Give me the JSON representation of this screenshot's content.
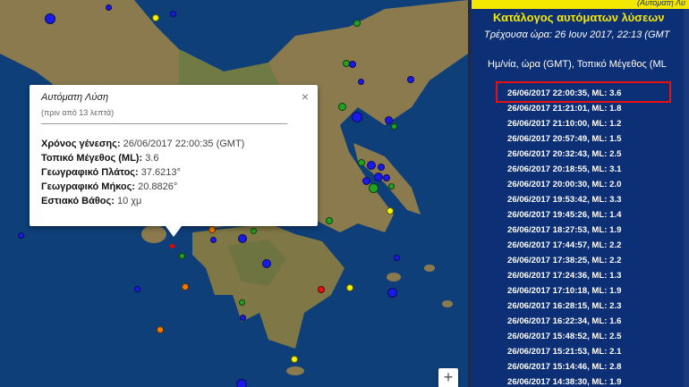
{
  "popup": {
    "title": "Αυτόματη Λύση",
    "subtitle": "(πριν από 13 λεπτά)",
    "close": "×",
    "rows": [
      {
        "label": "Χρόνος γένεσης:",
        "value": "26/06/2017  22:00:35 (GMT)"
      },
      {
        "label": "Τοπικό Μέγεθος (ML):",
        "value": "3.6"
      },
      {
        "label": "Γεωγραφικό Πλάτος:",
        "value": "37.6213°"
      },
      {
        "label": "Γεωγραφικό Μήκος:",
        "value": "20.8826°"
      },
      {
        "label": "Εστιακό Βάθος:",
        "value": "10 χμ"
      }
    ]
  },
  "map": {
    "zoom_in": "+"
  },
  "panel": {
    "top_label": "(Αυτόματη Λύ",
    "heading": "Κατάλογος αυτόματων λύσεων",
    "current_time": "Τρέχουσα ώρα: 26 Ιουν 2017, 22:13 (GMT",
    "columns": "Ημ/νία, ώρα (GMT), Τοπικό Μέγεθος (ML",
    "events": [
      "26/06/2017  22:00:35,   ML: 3.6",
      "26/06/2017  21:21:01,   ML: 1.8",
      "26/06/2017  21:10:00,   ML: 1.2",
      "26/06/2017  20:57:49,   ML: 1.5",
      "26/06/2017  20:32:43,   ML: 2.5",
      "26/06/2017  20:18:55,   ML: 3.1",
      "26/06/2017  20:00:30,   ML: 2.0",
      "26/06/2017  19:53:42,   ML: 3.3",
      "26/06/2017  19:45:26,   ML: 1.4",
      "26/06/2017  18:27:53,   ML: 1.9",
      "26/06/2017  17:44:57,   ML: 2.2",
      "26/06/2017  17:38:25,   ML: 2.2",
      "26/06/2017  17:24:36,   ML: 1.3",
      "26/06/2017  17:10:18,   ML: 1.9",
      "26/06/2017  16:28:15,   ML: 2.3",
      "26/06/2017  16:22:34,   ML: 1.6",
      "26/06/2017  15:48:52,   ML: 2.5",
      "26/06/2017  15:21:53,   ML: 2.1",
      "26/06/2017  15:14:46,   ML: 2.8",
      "26/06/2017  14:38:30,   ML: 1.9"
    ]
  }
}
